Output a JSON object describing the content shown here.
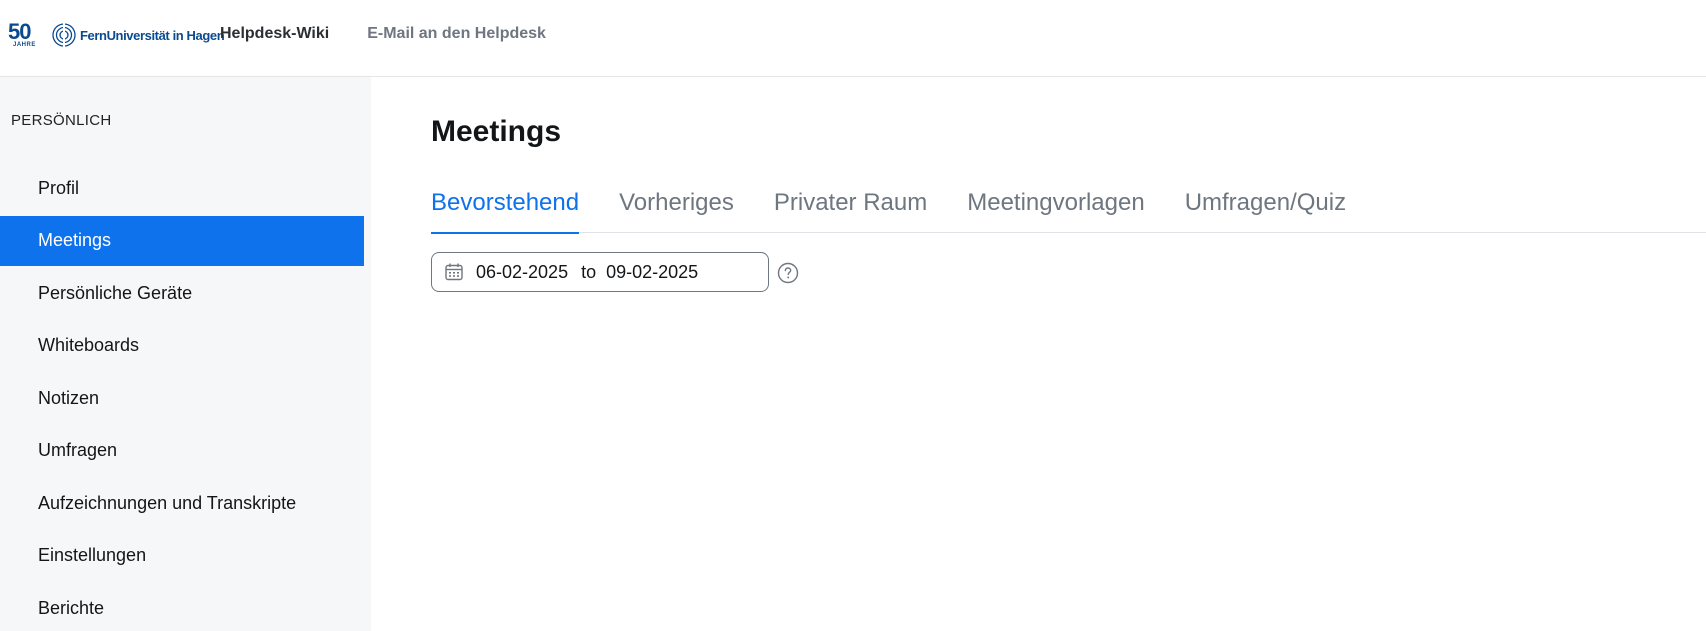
{
  "header": {
    "logo": {
      "anniversary_number": "50",
      "anniversary_label": "JAHRE",
      "university_name": "FernUniversität in Hagen",
      "brand_color": "#0b4a8f"
    },
    "nav": [
      {
        "label": "Helpdesk-Wiki"
      },
      {
        "label": "E-Mail an den Helpdesk"
      }
    ]
  },
  "sidebar": {
    "section_title": "PERSÖNLICH",
    "items": [
      {
        "label": "Profil",
        "active": false
      },
      {
        "label": "Meetings",
        "active": true
      },
      {
        "label": "Persönliche Geräte",
        "active": false
      },
      {
        "label": "Whiteboards",
        "active": false
      },
      {
        "label": "Notizen",
        "active": false
      },
      {
        "label": "Umfragen",
        "active": false
      },
      {
        "label": "Aufzeichnungen und Transkripte",
        "active": false
      },
      {
        "label": "Einstellungen",
        "active": false
      },
      {
        "label": "Berichte",
        "active": false
      }
    ],
    "active_color": "#0e72ed"
  },
  "main": {
    "title": "Meetings",
    "tabs": [
      {
        "label": "Bevorstehend",
        "active": true
      },
      {
        "label": "Vorheriges",
        "active": false
      },
      {
        "label": "Privater Raum",
        "active": false
      },
      {
        "label": "Meetingvorlagen",
        "active": false
      },
      {
        "label": "Umfragen/Quiz",
        "active": false
      }
    ],
    "date_range": {
      "icon": "calendar-icon",
      "start": "06-02-2025",
      "separator": "to",
      "end": "09-02-2025"
    },
    "help_icon": "question-circle-icon"
  }
}
